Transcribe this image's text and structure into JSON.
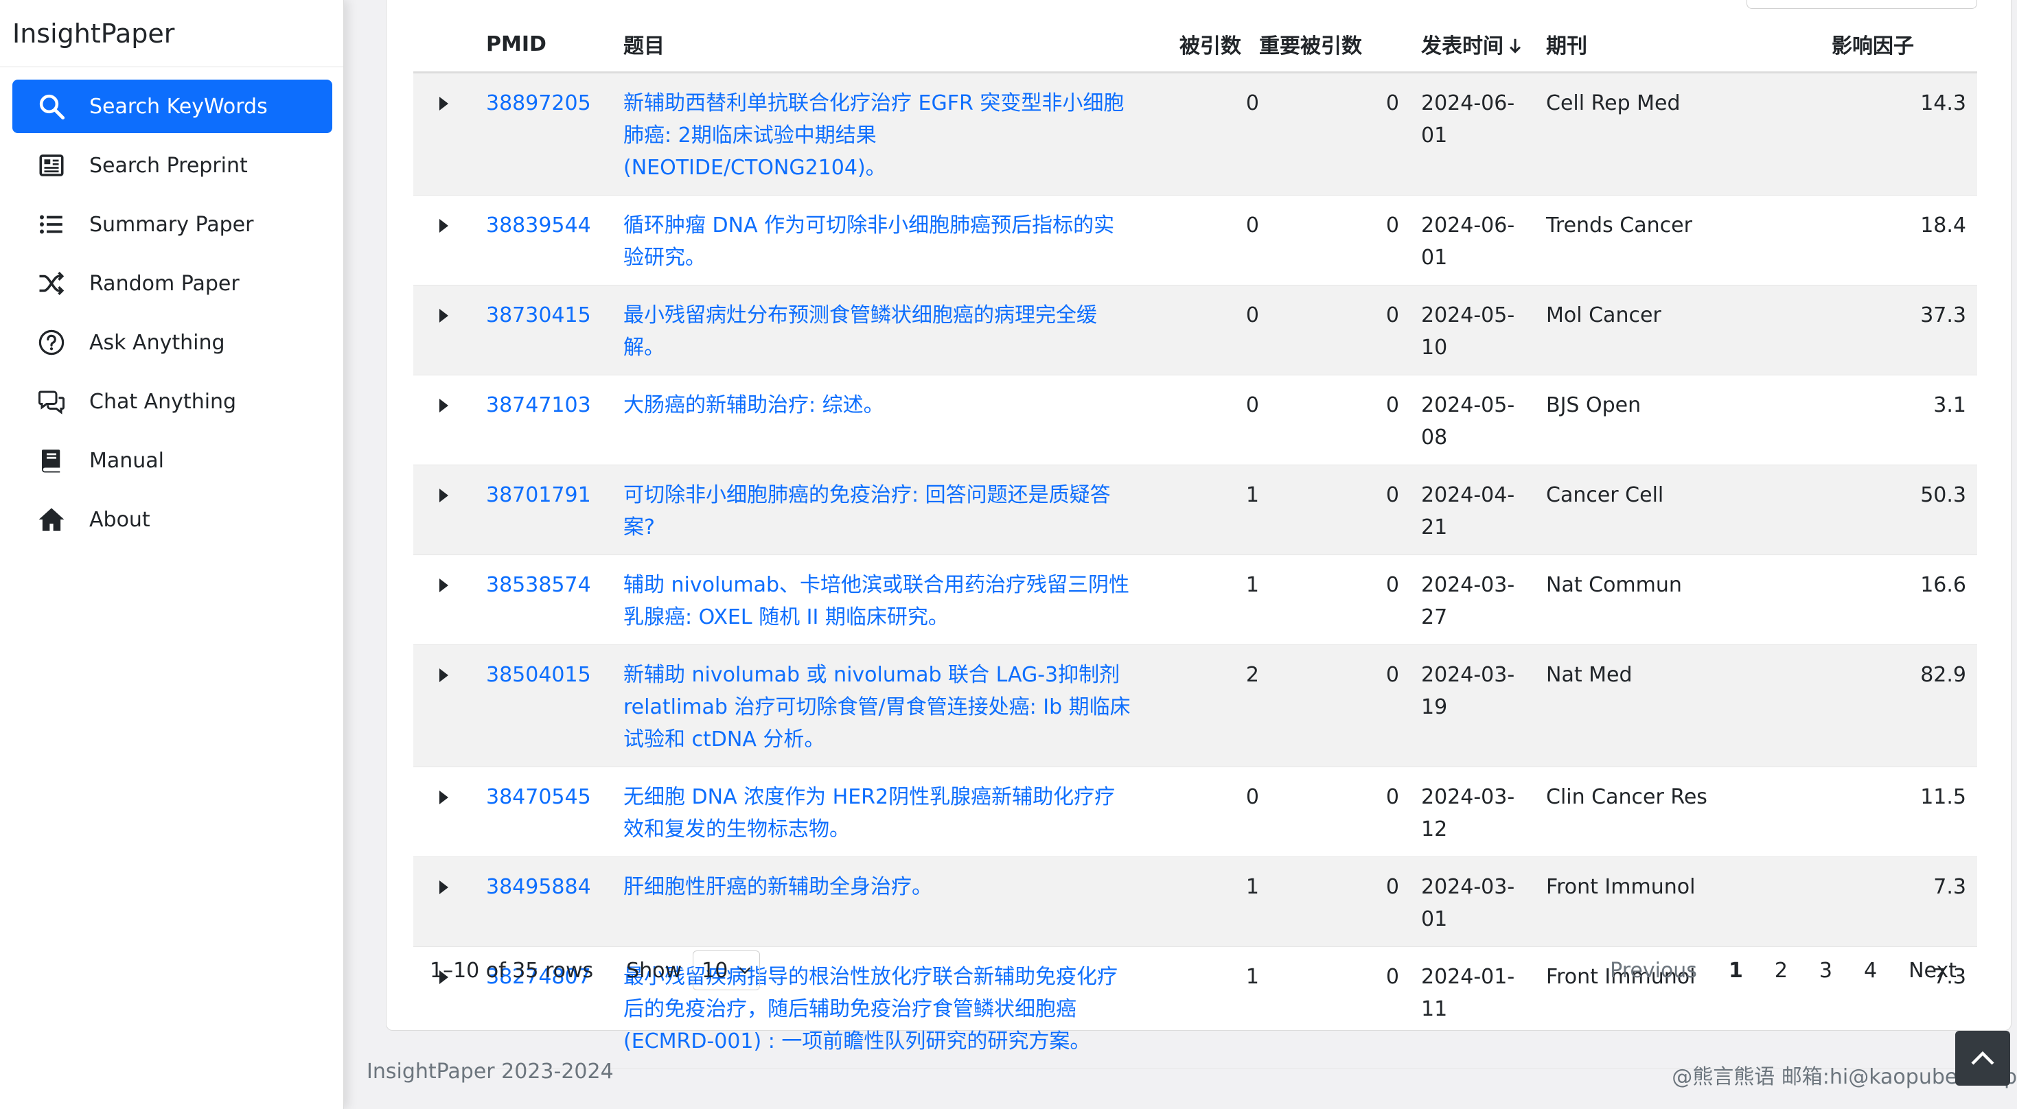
{
  "app": {
    "brand": "InsightPaper"
  },
  "sidebar": {
    "items": [
      {
        "label": "Search KeyWords",
        "icon": "search-icon",
        "active": true
      },
      {
        "label": "Search Preprint",
        "icon": "newspaper-icon",
        "active": false
      },
      {
        "label": "Summary Paper",
        "icon": "list-icon",
        "active": false
      },
      {
        "label": "Random Paper",
        "icon": "shuffle-icon",
        "active": false
      },
      {
        "label": "Ask Anything",
        "icon": "question-circle-icon",
        "active": false
      },
      {
        "label": "Chat Anything",
        "icon": "chat-icon",
        "active": false
      },
      {
        "label": "Manual",
        "icon": "book-icon",
        "active": false
      },
      {
        "label": "About",
        "icon": "home-icon",
        "active": false
      }
    ]
  },
  "table": {
    "headers": {
      "pmid": "PMID",
      "title": "题目",
      "cited": "被引数",
      "key_cited": "重要被引数",
      "date": "发表时间",
      "journal": "期刊",
      "impact": "影响因子"
    },
    "sort_icon": "arrow-down-icon",
    "rows": [
      {
        "pmid": "38897205",
        "title": "新辅助西替利单抗联合化疗治疗 EGFR 突变型非小细胞肺癌: 2期临床试验中期结果(NEOTIDE/CTONG2104)。",
        "cited": "0",
        "key_cited": "0",
        "date": "2024-06-01",
        "journal": "Cell Rep Med",
        "impact": "14.3"
      },
      {
        "pmid": "38839544",
        "title": "循环肿瘤 DNA 作为可切除非小细胞肺癌预后指标的实验研究。",
        "cited": "0",
        "key_cited": "0",
        "date": "2024-06-01",
        "journal": "Trends Cancer",
        "impact": "18.4"
      },
      {
        "pmid": "38730415",
        "title": "最小残留病灶分布预测食管鳞状细胞癌的病理完全缓解。",
        "cited": "0",
        "key_cited": "0",
        "date": "2024-05-10",
        "journal": "Mol Cancer",
        "impact": "37.3"
      },
      {
        "pmid": "38747103",
        "title": "大肠癌的新辅助治疗: 综述。",
        "cited": "0",
        "key_cited": "0",
        "date": "2024-05-08",
        "journal": "BJS Open",
        "impact": "3.1"
      },
      {
        "pmid": "38701791",
        "title": "可切除非小细胞肺癌的免疫治疗: 回答问题还是质疑答案?",
        "cited": "1",
        "key_cited": "0",
        "date": "2024-04-21",
        "journal": "Cancer Cell",
        "impact": "50.3"
      },
      {
        "pmid": "38538574",
        "title": "辅助 nivolumab、卡培他滨或联合用药治疗残留三阴性乳腺癌: OXEL 随机 II 期临床研究。",
        "cited": "1",
        "key_cited": "0",
        "date": "2024-03-27",
        "journal": "Nat Commun",
        "impact": "16.6"
      },
      {
        "pmid": "38504015",
        "title": "新辅助 nivolumab 或 nivolumab 联合 LAG-3抑制剂 relatlimab 治疗可切除食管/胃食管连接处癌: Ib 期临床试验和 ctDNA 分析。",
        "cited": "2",
        "key_cited": "0",
        "date": "2024-03-19",
        "journal": "Nat Med",
        "impact": "82.9"
      },
      {
        "pmid": "38470545",
        "title": "无细胞 DNA 浓度作为 HER2阴性乳腺癌新辅助化疗疗效和复发的生物标志物。",
        "cited": "0",
        "key_cited": "0",
        "date": "2024-03-12",
        "journal": "Clin Cancer Res",
        "impact": "11.5"
      },
      {
        "pmid": "38495884",
        "title": "肝细胞性肝癌的新辅助全身治疗。",
        "cited": "1",
        "key_cited": "0",
        "date": "2024-03-01",
        "journal": "Front Immunol",
        "impact": "7.3"
      },
      {
        "pmid": "38274807",
        "title": "最小残留疾病指导的根治性放化疗联合新辅助免疫化疗后的免疫治疗，随后辅助免疫治疗食管鳞状细胞癌 (ECMRD-001) : 一项前瞻性队列研究的研究方案。",
        "cited": "1",
        "key_cited": "0",
        "date": "2024-01-11",
        "journal": "Front Immunol",
        "impact": "7.3"
      }
    ]
  },
  "pagination": {
    "rows_info": "1–10 of 35 rows",
    "show_label": "Show",
    "page_size": "10",
    "previous": "Previous",
    "pages": [
      "1",
      "2",
      "3",
      "4"
    ],
    "current_page": "1",
    "next": "Next"
  },
  "footer": {
    "left": "InsightPaper 2023-2024",
    "right": "@熊言熊语 邮箱:hi@kaopubear.top"
  },
  "colors": {
    "accent": "#0d6efd",
    "back_to_top_bg": "#343a40"
  }
}
